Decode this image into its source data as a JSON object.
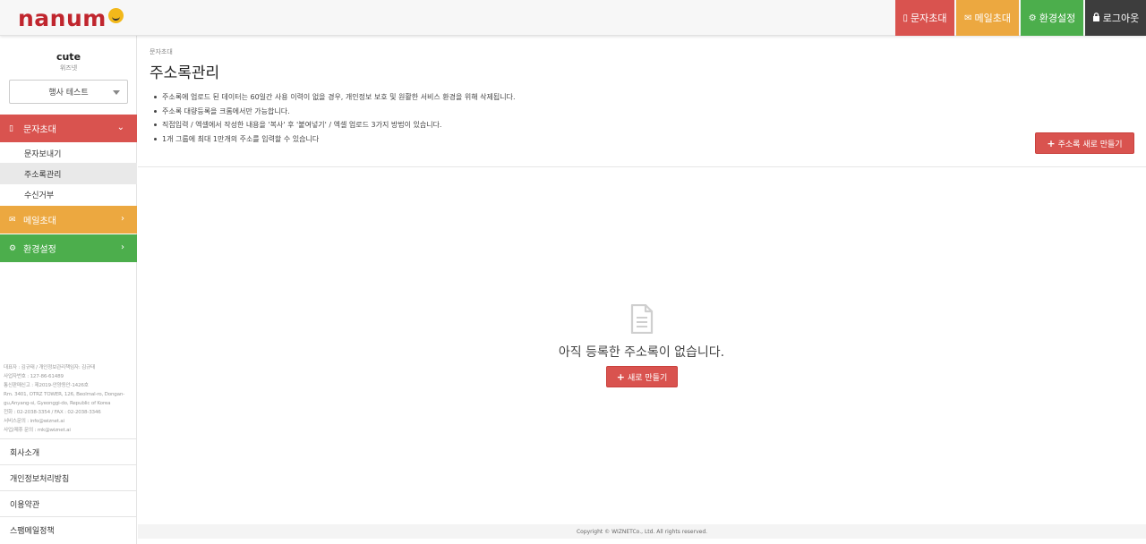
{
  "brand": {
    "part1": "nanum",
    "part2": "e"
  },
  "topnav": {
    "sms": "문자초대",
    "mail": "메일초대",
    "settings": "환경설정",
    "logout": "로그아웃"
  },
  "sidebar": {
    "user_name": "cute",
    "user_sub": "위즈넷",
    "select_value": "행사 테스트",
    "menu_sms": "문자초대",
    "sms_items": [
      "문자보내기",
      "주소록관리",
      "수신거부"
    ],
    "menu_mail": "메일초대",
    "menu_settings": "환경설정",
    "company_info": [
      "대표자 : 김규태 / 개인정보관리책임자: 김규태",
      "사업자번호 : 127-86-61489",
      "통신판매신고 : 제2019-안양동안-1426호",
      "Rm. 3401, OTRZ TOWER, 126, Beolmal-ro, Dongan-",
      "gu,Anyang-si, Gyeonggi-do, Republic of Korea",
      "전화 : 02-2038-3354 / FAX : 02-2038-3346",
      "서비스문의 : info@wiznet.ai",
      "사업/제휴 문의 : mk@wiznet.ai"
    ],
    "footer_links": [
      "회사소개",
      "개인정보처리방침",
      "이용약관",
      "스팸메일정책"
    ]
  },
  "main": {
    "breadcrumb": "문자초대",
    "title": "주소록관리",
    "notes": [
      "주소록에 업로드 된 데이터는 60일간 사용 이력이 없을 경우, 개인정보 보호 및 원활한 서비스 환경을 위해 삭제됩니다.",
      "주소록 대량등록을 크롬에서만 가능합니다.",
      "직접입력 / 엑셀에서 작성한 내용을 '복사' 후 '붙여넣기' / 엑셀 업로드 3가지 방법이 있습니다.",
      "1개 그룹에 최대 1만개의 주소를 입력할 수 있습니다"
    ],
    "new_addressbook_button": "주소록 새로 만들기",
    "empty_text": "아직 등록한 주소록이 없습니다.",
    "new_button": "새로 만들기",
    "copyright": "Copyright © WIZNETCo., Ltd. All rights reserved."
  },
  "colors": {
    "sms": "#d9534f",
    "mail": "#eca840",
    "settings": "#4cae4c",
    "logout": "#3d3d3d"
  }
}
